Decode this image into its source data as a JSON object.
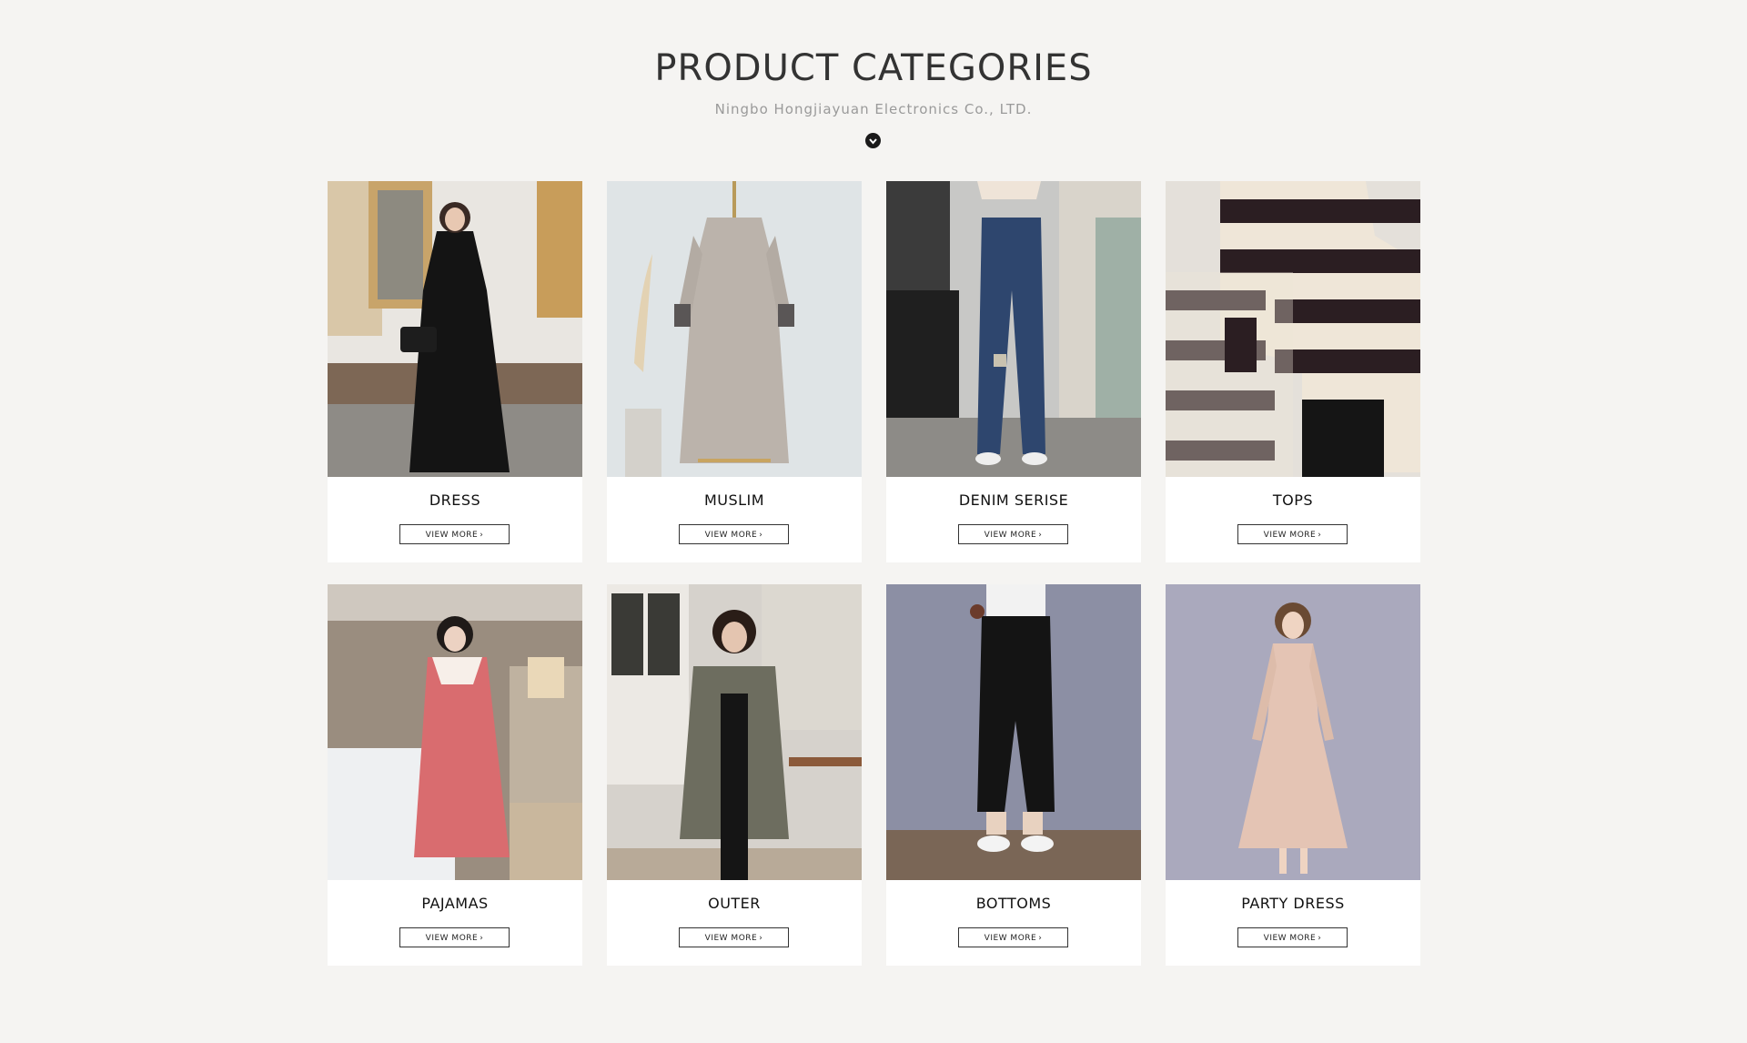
{
  "header": {
    "title": "PRODUCT CATEGORIES",
    "subtitle": "Ningbo Hongjiayuan Electronics Co., LTD."
  },
  "categories": [
    {
      "name": "DRESS",
      "button": "VIEW MORE"
    },
    {
      "name": "MUSLIM",
      "button": "VIEW MORE"
    },
    {
      "name": "DENIM SERISE",
      "button": "VIEW MORE"
    },
    {
      "name": "TOPS",
      "button": "VIEW MORE"
    },
    {
      "name": "PAJAMAS",
      "button": "VIEW MORE"
    },
    {
      "name": "OUTER",
      "button": "VIEW MORE"
    },
    {
      "name": "BOTTOMS",
      "button": "VIEW MORE"
    },
    {
      "name": "PARTY DRESS",
      "button": "VIEW MORE"
    }
  ],
  "icons": {
    "scroll": "chevron-down-icon",
    "button_arrow": "chevron-right-icon"
  }
}
